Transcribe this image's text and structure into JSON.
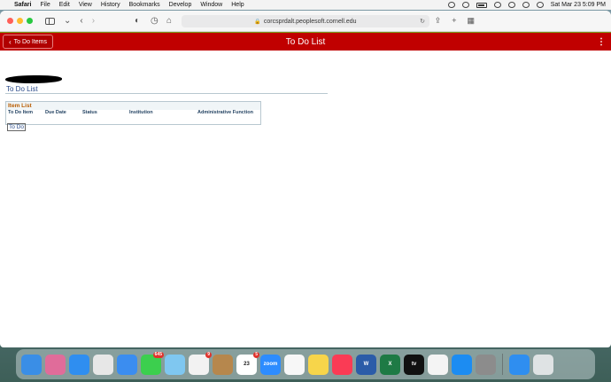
{
  "menubar": {
    "apple": "",
    "items": [
      "Safari",
      "File",
      "Edit",
      "View",
      "History",
      "Bookmarks",
      "Develop",
      "Window",
      "Help"
    ],
    "datetime": "Sat Mar 23  5:09 PM"
  },
  "browser": {
    "url": "corcsprdalt.peoplesoft.cornell.edu"
  },
  "header": {
    "back_label": "To Do Items",
    "title": "To Do List",
    "menu_glyph": "⋮"
  },
  "page": {
    "heading": "To Do List",
    "grid": {
      "title": "Item List",
      "columns": [
        "To Do Item",
        "Due Date",
        "Status",
        "Institution",
        "Administrative Function"
      ],
      "row_link": "To Do"
    }
  },
  "dock": {
    "apps": [
      {
        "name": "finder",
        "color": "#3a8ee6",
        "label": "",
        "badge": ""
      },
      {
        "name": "launchpad",
        "color": "#e06c9a",
        "label": "",
        "badge": ""
      },
      {
        "name": "safari",
        "color": "#2f8ef0",
        "label": "",
        "badge": ""
      },
      {
        "name": "chrome",
        "color": "#e7e7e7",
        "label": "",
        "badge": ""
      },
      {
        "name": "mail",
        "color": "#3b8df0",
        "label": "",
        "badge": ""
      },
      {
        "name": "messages",
        "color": "#3ccf4e",
        "label": "",
        "badge": "645"
      },
      {
        "name": "maps",
        "color": "#7fc7f0",
        "label": "",
        "badge": ""
      },
      {
        "name": "photos",
        "color": "#f2f2f2",
        "label": "",
        "badge": "9"
      },
      {
        "name": "contacts",
        "color": "#b6874d",
        "label": "",
        "badge": ""
      },
      {
        "name": "calendar",
        "color": "#ffffff",
        "label": "23",
        "badge": "5"
      },
      {
        "name": "zoom",
        "color": "#2d8cff",
        "label": "zoom",
        "badge": ""
      },
      {
        "name": "reminders",
        "color": "#f7f7f7",
        "label": "",
        "badge": ""
      },
      {
        "name": "notes",
        "color": "#f7d54a",
        "label": "",
        "badge": ""
      },
      {
        "name": "music",
        "color": "#fa3b55",
        "label": "",
        "badge": ""
      },
      {
        "name": "word",
        "color": "#2b5ca8",
        "label": "W",
        "badge": ""
      },
      {
        "name": "excel",
        "color": "#1e7a45",
        "label": "X",
        "badge": ""
      },
      {
        "name": "apple-tv",
        "color": "#111111",
        "label": "tv",
        "badge": ""
      },
      {
        "name": "news",
        "color": "#f4f4f4",
        "label": "",
        "badge": ""
      },
      {
        "name": "app-store",
        "color": "#1c8cf2",
        "label": "",
        "badge": ""
      },
      {
        "name": "system-settings",
        "color": "#8c8c8c",
        "label": "",
        "badge": ""
      },
      {
        "name": "safari-window",
        "color": "#2f8ef0",
        "label": "",
        "badge": ""
      },
      {
        "name": "trash",
        "color": "#dfe3e4",
        "label": "",
        "badge": ""
      }
    ]
  }
}
